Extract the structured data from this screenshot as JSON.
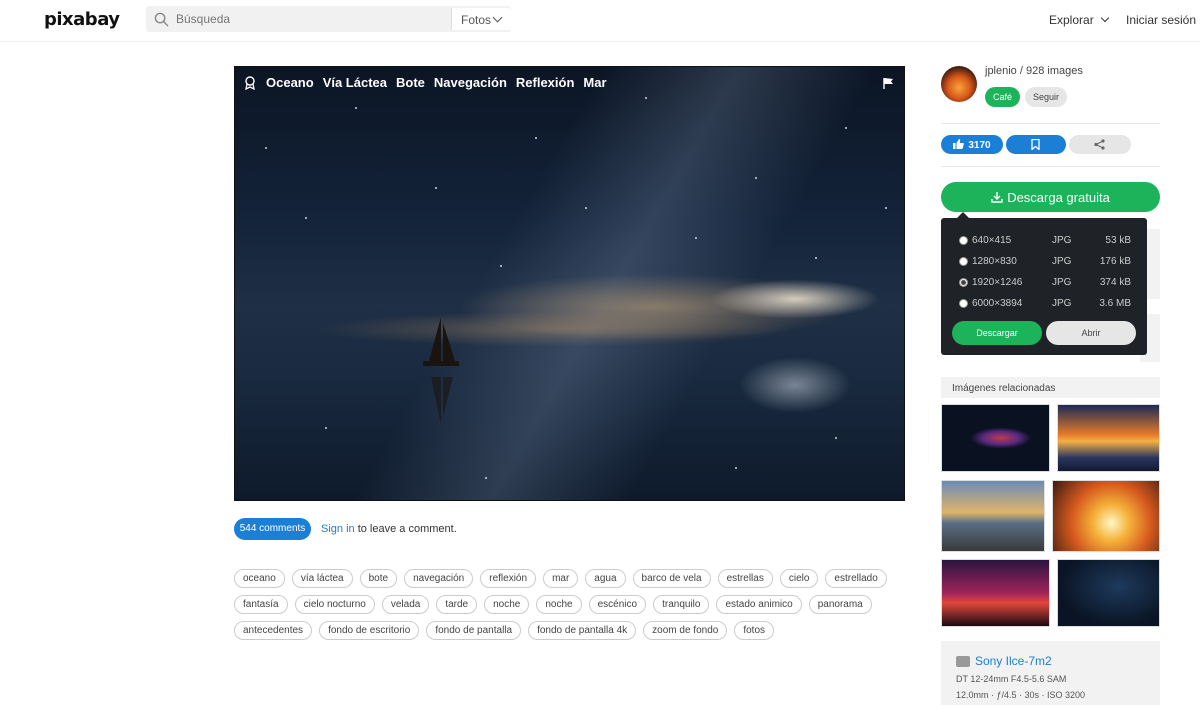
{
  "header": {
    "logo": "pixabay",
    "search_placeholder": "Búsqueda",
    "category": "Fotos",
    "explore": "Explorar",
    "login": "Iniciar sesión"
  },
  "photo": {
    "tags": [
      "Oceano",
      "Vía Láctea",
      "Bote",
      "Navegación",
      "Reflexión",
      "Mar"
    ]
  },
  "comments": {
    "count_label": "544 comments",
    "signin_link": "Sign in",
    "signin_rest": " to leave a comment."
  },
  "tags": [
    [
      "oceano",
      "vía láctea",
      "bote",
      "navegación",
      "reflexión",
      "mar",
      "agua",
      "barco de vela",
      "estrellas",
      "cielo",
      "estrellado"
    ],
    [
      "fantasía",
      "cielo nocturno",
      "velada",
      "tarde",
      "noche",
      "noche",
      "escénico",
      "tranquilo",
      "estado animico",
      "panorama"
    ],
    [
      "antecedentes",
      "fondo de escritorio",
      "fondo de pantalla",
      "fondo de pantalla 4k",
      "zoom de fondo",
      "fotos"
    ]
  ],
  "author": {
    "name_line": "jplenio / 928 images",
    "cafe_label": "Café",
    "follow_label": "Seguir"
  },
  "actions": {
    "likes": "3170"
  },
  "download": {
    "button_label": "Descarga gratuita",
    "options": [
      {
        "res": "640×415",
        "format": "JPG",
        "size": "53 kB",
        "selected": false
      },
      {
        "res": "1280×830",
        "format": "JPG",
        "size": "176 kB",
        "selected": false
      },
      {
        "res": "1920×1246",
        "format": "JPG",
        "size": "374 kB",
        "selected": true
      },
      {
        "res": "6000×3894",
        "format": "JPG",
        "size": "3.6 MB",
        "selected": false
      }
    ],
    "download_label": "Descargar",
    "open_label": "Abrir"
  },
  "related": {
    "title": "Imágenes relacionadas"
  },
  "camera": {
    "model": "Sony Ilce-7m2",
    "lens": "DT 12-24mm F4.5-5.6 SAM",
    "exif": "12.0mm · ƒ/4.5 · 30s · ISO 3200"
  },
  "colors": {
    "accent_blue": "#1c7fd6",
    "accent_green": "#1cb35a",
    "dropdown_bg": "#1f2227"
  }
}
